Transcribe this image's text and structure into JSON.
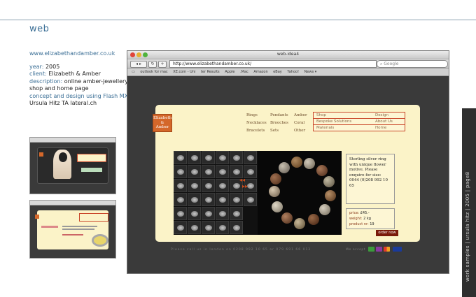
{
  "section_title": "web",
  "project": {
    "url_text": "www.elizabethandamber.co.uk",
    "year_label": "year:",
    "year_value": "2005",
    "client_label": "client:",
    "client_value": "Elizabeth & Amber",
    "description_label": "description:",
    "description_value_1": "online amber-jewellery",
    "description_value_2": "shop and home page",
    "concept_label": "concept and design using Flash MX:",
    "concept_value": "Ursula Hitz TA lateral.ch"
  },
  "browser": {
    "window_title": "web-idea4",
    "address": "http://www.elizabethandamber.co.uk/",
    "search_placeholder": "Google",
    "bookmarks": [
      "outlook for mac",
      "XE.com - Uni",
      "ter Results",
      "Apple",
      ".Mac",
      "Amazon",
      "eBay",
      "Yahoo!",
      "News ▾"
    ]
  },
  "site": {
    "logo_line1": "Elizabeth",
    "logo_line2": "&",
    "logo_line3": "Amber",
    "categories": {
      "rings": "Rings",
      "pendants": "Pendants",
      "amber": "Amber",
      "necklaces": "Necklaces",
      "brooches": "Brooches",
      "coral": "Coral",
      "bracelets": "Bracelets",
      "sets": "Sets",
      "other": "Other"
    },
    "menu": {
      "shop": "Shop",
      "design": "Design",
      "bespoke": "Bespoke Solutions",
      "about": "About Us",
      "materials": "Materials",
      "home": "Home"
    },
    "product_description": "Sterling silver ring with unique flower motive. Please enquire for size: 0044 (0)208 992 10 65",
    "price_label": "price:",
    "price_value": "£45.-",
    "weight_label": "weight:",
    "weight_value": "2 kg",
    "product_label": "product nr:",
    "product_value": "19",
    "order_button": "order now",
    "footer_call": "Please call us in london on 0208 992 10 65 or 079 691 66 013",
    "footer_accept": "We accept"
  },
  "sidebar_label": "work samples | ursula hitz | 2005 | page8",
  "colors": {
    "accent_blue": "#3a6e95",
    "site_cream": "#fbf3c8",
    "brand_orange": "#d4672a",
    "order_red": "#7a1a0a"
  }
}
